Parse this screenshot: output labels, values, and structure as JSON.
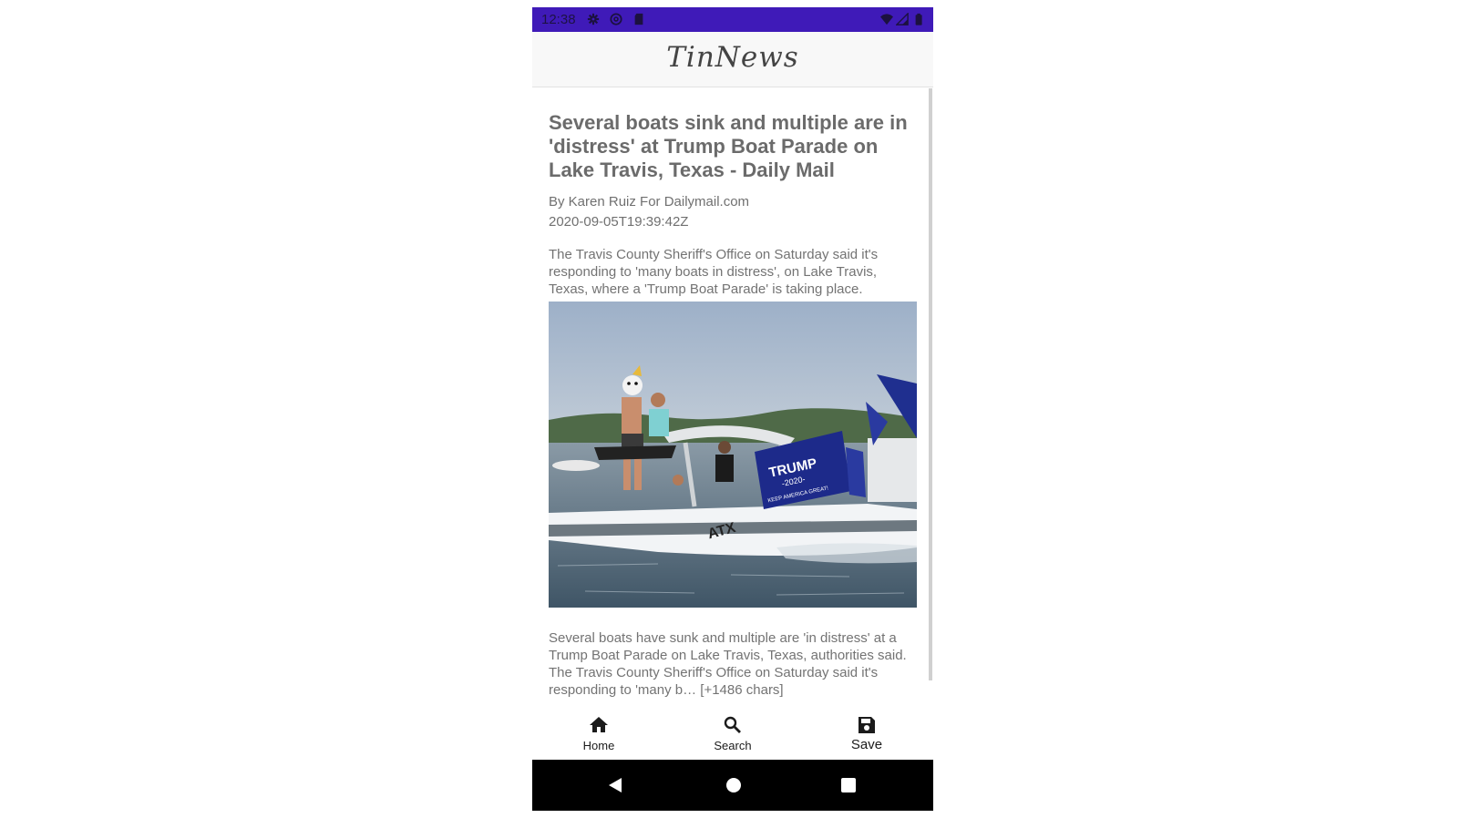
{
  "status_bar": {
    "time": "12:38",
    "left_icons": [
      "settings-icon",
      "at-sign-icon",
      "sd-card-icon"
    ],
    "right_icons": [
      "wifi-icon",
      "signal-icon",
      "battery-icon"
    ],
    "color": "#3f1ab8"
  },
  "app_bar": {
    "title": "TinNews"
  },
  "article": {
    "title": "Several boats sink and multiple are in 'distress' at Trump Boat Parade on Lake Travis, Texas - Daily Mail",
    "author": "By Karen Ruiz For Dailymail.com",
    "published_at": "2020-09-05T19:39:42Z",
    "description": "The Travis County Sheriff's Office on Saturday said it's responding to 'many boats in distress', on Lake Travis, Texas, where a 'Trump Boat Parade' is taking place.",
    "image": {
      "flag_text_main": "TRUMP",
      "flag_text_year": "-2020-",
      "flag_text_slogan": "KEEP AMERICA GREAT!",
      "boat_text": "ATX"
    },
    "content_line1": "Several boats have sunk and multiple are 'in distress' at a Trump Boat Parade on Lake Travis, Texas, authorities said.",
    "content_line2": "The Travis County Sheriff's Office on Saturday said it's responding to 'many b… [+1486 chars]"
  },
  "bottom_nav": {
    "items": [
      {
        "label": "Home",
        "icon": "home-icon",
        "active": false
      },
      {
        "label": "Search",
        "icon": "search-icon",
        "active": false
      },
      {
        "label": "Save",
        "icon": "save-icon",
        "active": true
      }
    ]
  },
  "system_nav": {
    "buttons": [
      "back-icon",
      "home-circle-icon",
      "recents-icon"
    ]
  }
}
